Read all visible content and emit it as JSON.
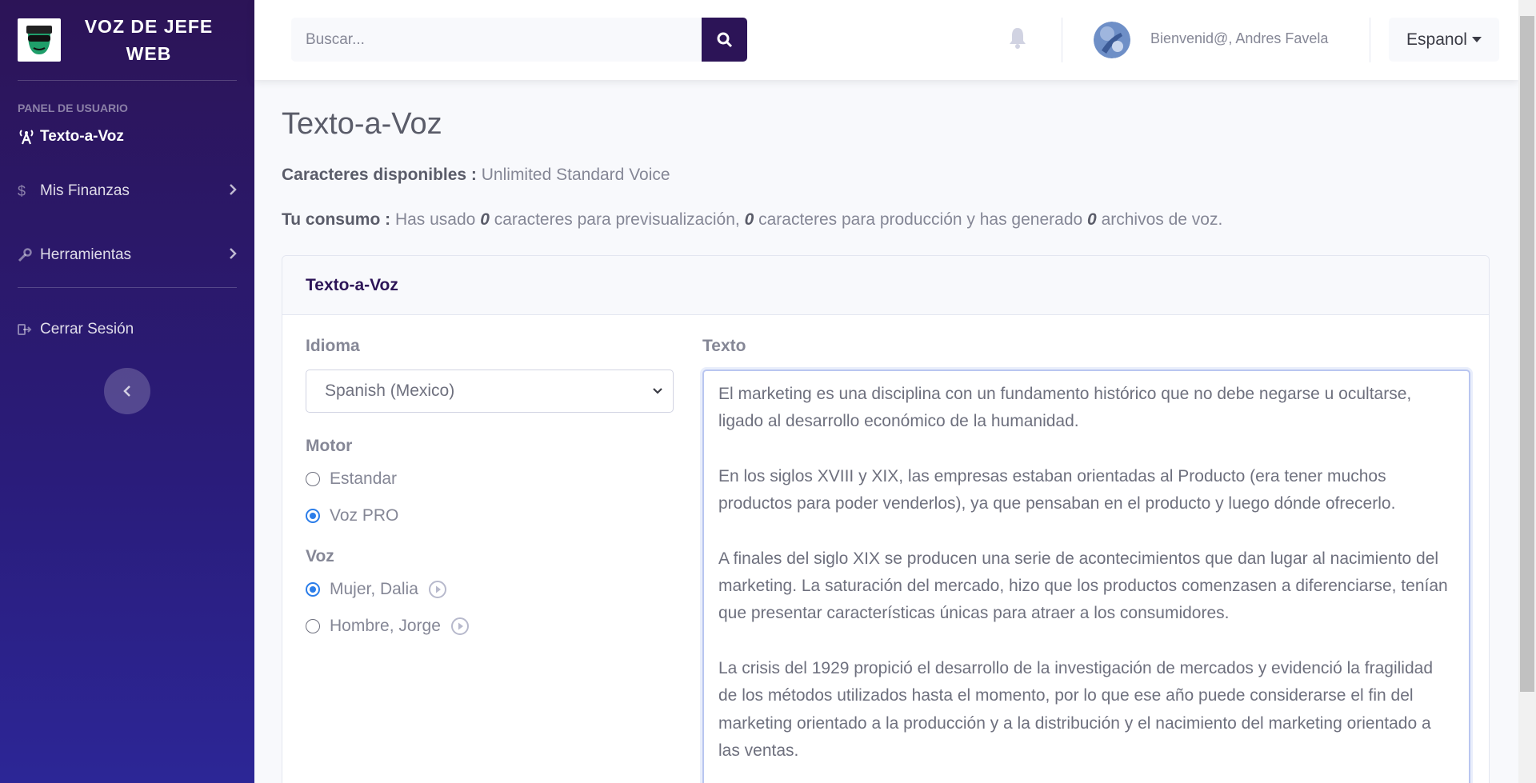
{
  "brand": {
    "title": "VOZ DE JEFE WEB",
    "logo": "mascot-logo"
  },
  "sidebar": {
    "heading": "PANEL DE USUARIO",
    "items": [
      {
        "label": "Texto-a-Voz",
        "icon": "broadcast-icon",
        "active": true
      },
      {
        "label": "Mis Finanzas",
        "icon": "dollar-icon",
        "has_submenu": true
      },
      {
        "label": "Herramientas",
        "icon": "wrench-icon",
        "has_submenu": true
      }
    ],
    "logout": {
      "label": "Cerrar Sesión",
      "icon": "sign-out-icon"
    },
    "toggle_icon": "chevron-left-icon"
  },
  "topbar": {
    "search_placeholder": "Buscar...",
    "welcome": "Bienvenid@, Andres Favela",
    "language": "Espanol"
  },
  "page": {
    "title": "Texto-a-Voz",
    "available_label": "Caracteres disponibles :",
    "available_value": "Unlimited Standard Voice",
    "usage_label": "Tu consumo :",
    "usage_part1": "Has usado",
    "preview_count": "0",
    "usage_part2": "caracteres para previsualización,",
    "production_count": "0",
    "usage_part3": "caracteres para producción y has generado",
    "files_count": "0",
    "usage_part4": "archivos de voz."
  },
  "card": {
    "title": "Texto-a-Voz",
    "language_label": "Idioma",
    "language_value": "Spanish (Mexico)",
    "engine_label": "Motor",
    "engines": [
      {
        "label": "Estandar",
        "selected": false
      },
      {
        "label": "Voz PRO",
        "selected": true
      }
    ],
    "voice_label": "Voz",
    "voices": [
      {
        "label": "Mujer, Dalia",
        "selected": true
      },
      {
        "label": "Hombre, Jorge",
        "selected": false
      }
    ],
    "text_label": "Texto",
    "text_paragraphs": [
      "El marketing es una disciplina con un fundamento histórico que no debe negarse u ocultarse, ligado al desarrollo económico de la humanidad.",
      "En los siglos XVIII y XIX, las empresas estaban orientadas al Producto (era tener muchos productos para poder venderlos), ya que pensaban en el producto y luego dónde ofrecerlo.",
      "A finales del siglo XIX se producen una serie de acontecimientos que dan lugar al nacimiento del marketing. La saturación del mercado, hizo que los productos comenzasen a diferenciarse, tenían que presentar características únicas para atraer a los consumidores.",
      "La crisis del 1929 propició el desarrollo de la investigación de mercados y evidenció la fragilidad de los métodos utilizados hasta el momento, por lo que ese año puede considerarse el fin del marketing orientado a la producción y a la distribución y el nacimiento del marketing orientado a las ventas."
    ]
  },
  "colors": {
    "sidebar_top": "#2c1457",
    "sidebar_bottom": "#2c2696",
    "accent": "#2c1457",
    "radio": "#2b7de9"
  }
}
